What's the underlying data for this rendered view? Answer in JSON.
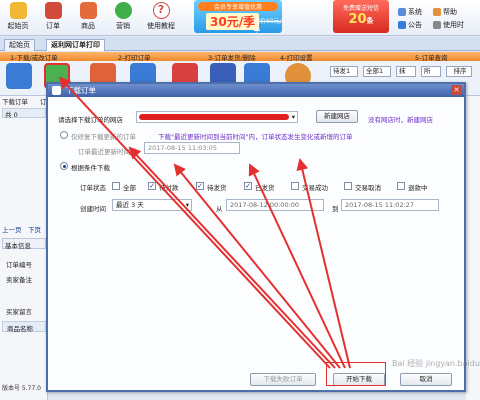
{
  "toolbar": {
    "items": [
      {
        "label": "起始页",
        "color": "#f1b735"
      },
      {
        "label": "订单",
        "color": "#d24a3b"
      },
      {
        "label": "商品",
        "color": "#e66b3a"
      },
      {
        "label": "营销",
        "color": "#3fae49"
      },
      {
        "label": "使用教程",
        "color": "#d44a4a"
      }
    ],
    "ad1": {
      "top": "会员专享增值优惠",
      "price": "30元/季",
      "old": "原价60元/季"
    },
    "ad2": {
      "top": "免费赠送短信",
      "num": "20",
      "unit": "条"
    },
    "right_items": [
      {
        "label": "系统",
        "color": "#5b8ad8"
      },
      {
        "label": "帮助",
        "color": "#e0913a"
      },
      {
        "label": "公告",
        "color": "#3a7ad8"
      },
      {
        "label": "使用时",
        "color": "#888888"
      }
    ]
  },
  "tabs": [
    {
      "label": "起始页",
      "active": false
    },
    {
      "label": "返利网订单打印",
      "active": true
    }
  ],
  "sections": [
    "1-下载/或改订单",
    "2-打印订单",
    "3-订单发货/删除",
    "4-打印设置",
    "5-订单查询"
  ],
  "tools": {
    "dropdowns": [
      "待发1",
      "全部1",
      "抹",
      "所",
      "排序"
    ]
  },
  "left_panel": {
    "download_label": "下载订单",
    "order_label": "订单",
    "col_label": "共 0",
    "prev": "上一页",
    "next": "下页",
    "tabs": [
      "基本信息",
      "跟"
    ],
    "rows": [
      "订单编号",
      "卖家备注",
      "买家留言"
    ],
    "product": "商品名称",
    "version": "版本号 5.77.0"
  },
  "dialog": {
    "title": "下载订单",
    "shop_label": "请选择下载订单的网店",
    "new_shop_button": "新建网店",
    "no_shop_text": "没有网店时，新建网店",
    "opt_update": "仅修复下载更新的订单",
    "update_note": "下载\"最近更新时间到当前时间\"内，订单状态发生变化或新增的订单",
    "last_update_label": "订单最近更新时间",
    "last_update_value": "2017-08-15 11:03:05",
    "opt_condition": "根据条件下载",
    "status_label": "订单状态",
    "statuses": [
      {
        "label": "全部",
        "checked": false
      },
      {
        "label": "待付款",
        "checked": true
      },
      {
        "label": "待发货",
        "checked": true
      },
      {
        "label": "已发货",
        "checked": true
      },
      {
        "label": "交易成功",
        "checked": false
      },
      {
        "label": "交易取消",
        "checked": false
      },
      {
        "label": "退款中",
        "checked": false
      }
    ],
    "create_time_label": "创建时间",
    "range_value": "最近 3 天",
    "from_label": "从",
    "from_value": "2017-08-12 00:00:00",
    "to_label": "到",
    "to_value": "2017-08-15 11:02:27",
    "stop_button": "下载失败订单",
    "start_button": "开始下载",
    "cancel_button": "取消"
  },
  "watermark": "Bai 经验 jingyan.baidu.com",
  "colors": {
    "accent": "#e53030",
    "title_bar": "#4f6fa8"
  }
}
